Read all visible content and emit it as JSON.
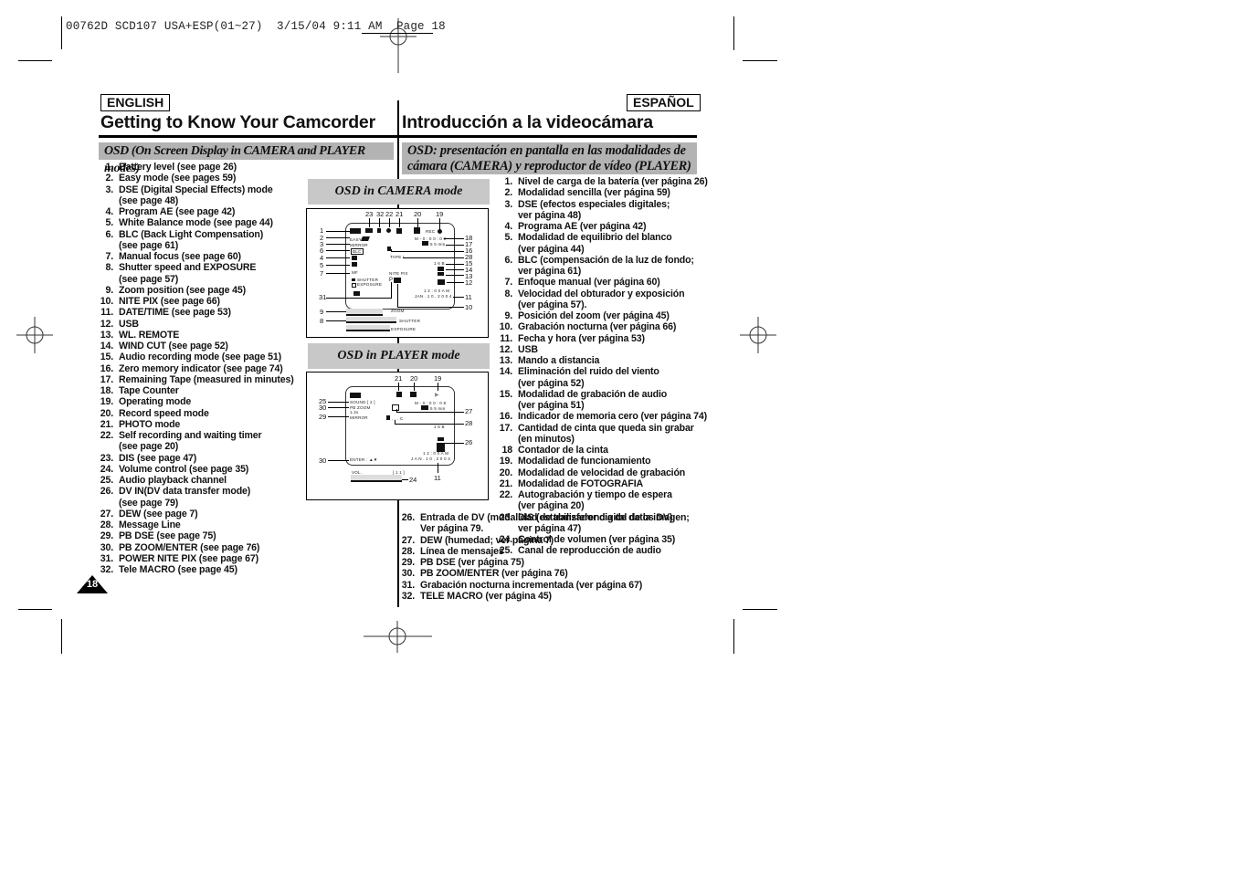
{
  "slug_line": "00762D SCD107 USA+ESP(01~27)  3/15/04 9:11 AM  Page 18",
  "english": {
    "lang_tag": "ENGLISH",
    "title": "Getting to Know Your Camcorder",
    "section_banner": "OSD (On Screen Display in CAMERA and PLAYER modes)",
    "items": [
      {
        "n": "1.",
        "t": "Battery level (see page 26)"
      },
      {
        "n": "2.",
        "t": "Easy mode (see pages 59)"
      },
      {
        "n": "3.",
        "t": "DSE (Digital Special Effects) mode"
      },
      {
        "n": "",
        "t": "(see page 48)"
      },
      {
        "n": "4.",
        "t": "Program AE (see page 42)"
      },
      {
        "n": "5.",
        "t": "White Balance mode (see page 44)"
      },
      {
        "n": "6.",
        "t": "BLC (Back Light Compensation)"
      },
      {
        "n": "",
        "t": "(see page 61)"
      },
      {
        "n": "7.",
        "t": "Manual focus (see page 60)"
      },
      {
        "n": "8.",
        "t": "Shutter speed and EXPOSURE"
      },
      {
        "n": "",
        "t": "(see page 57)"
      },
      {
        "n": "9.",
        "t": "Zoom position (see page 45)"
      },
      {
        "n": "10.",
        "t": "NITE PIX (see page 66)"
      },
      {
        "n": "11.",
        "t": "DATE/TIME (see page 53)"
      },
      {
        "n": "12.",
        "t": "USB"
      },
      {
        "n": "13.",
        "t": "WL. REMOTE"
      },
      {
        "n": "14.",
        "t": "WIND CUT (see page 52)"
      },
      {
        "n": "15.",
        "t": "Audio recording mode (see page 51)"
      },
      {
        "n": "16.",
        "t": "Zero memory indicator (see page 74)"
      },
      {
        "n": "17.",
        "t": "Remaining Tape (measured in minutes)"
      },
      {
        "n": "18.",
        "t": "Tape Counter"
      },
      {
        "n": "19.",
        "t": "Operating mode"
      },
      {
        "n": "20.",
        "t": "Record speed mode"
      },
      {
        "n": "21.",
        "t": "PHOTO mode"
      },
      {
        "n": "22.",
        "t": "Self recording and waiting timer"
      },
      {
        "n": "",
        "t": "(see page 20)"
      },
      {
        "n": "23.",
        "t": "DIS (see page 47)"
      },
      {
        "n": "24.",
        "t": "Volume control (see page 35)"
      },
      {
        "n": "25.",
        "t": "Audio playback channel"
      },
      {
        "n": "26.",
        "t": "DV IN(DV data transfer mode)"
      },
      {
        "n": "",
        "t": "(see page 79)"
      },
      {
        "n": "27.",
        "t": "DEW (see page 7)"
      },
      {
        "n": "28.",
        "t": "Message Line"
      },
      {
        "n": "29.",
        "t": "PB DSE (see page 75)"
      },
      {
        "n": "30.",
        "t": "PB ZOOM/ENTER (see page 76)"
      },
      {
        "n": "31.",
        "t": "POWER NITE PIX (see page 67)"
      },
      {
        "n": "32.",
        "t": "Tele MACRO (see page 45)"
      }
    ],
    "page_number": "18"
  },
  "spanish": {
    "lang_tag": "ESPAÑOL",
    "title": "Introducción a la videocámara",
    "section_banner_line1": "OSD: presentación en pantalla en las modalidades de",
    "section_banner_line2": "cámara (CAMERA) y reproductor de vídeo (PLAYER)",
    "items_a": [
      {
        "n": "1.",
        "t": "Nivel de carga de la batería (ver página 26)"
      },
      {
        "n": "2.",
        "t": "Modalidad sencilla (ver página 59)"
      },
      {
        "n": "3.",
        "t": "DSE (efectos especiales digitales;"
      },
      {
        "n": "",
        "t": "ver página 48)"
      },
      {
        "n": "4.",
        "t": "Programa AE (ver página 42)"
      },
      {
        "n": "5.",
        "t": "Modalidad de equilibrio del blanco"
      },
      {
        "n": "",
        "t": "(ver página 44)"
      },
      {
        "n": "6.",
        "t": "BLC (compensación de la luz de fondo;"
      },
      {
        "n": "",
        "t": "ver página 61)"
      },
      {
        "n": "7.",
        "t": "Enfoque manual (ver página 60)"
      },
      {
        "n": "8.",
        "t": "Velocidad del obturador y exposición"
      },
      {
        "n": "",
        "t": "(ver página 57)."
      },
      {
        "n": "9.",
        "t": "Posición del zoom (ver página 45)"
      },
      {
        "n": "10.",
        "t": "Grabación nocturna (ver página 66)"
      },
      {
        "n": "11.",
        "t": "Fecha y hora (ver página 53)"
      },
      {
        "n": "12.",
        "t": "USB"
      },
      {
        "n": "13.",
        "t": "Mando a distancia"
      },
      {
        "n": "14.",
        "t": "Eliminación del ruido del viento"
      },
      {
        "n": "",
        "t": "(ver página 52)"
      },
      {
        "n": "15.",
        "t": "Modalidad de grabación de audio"
      },
      {
        "n": "",
        "t": "(ver página 51)"
      },
      {
        "n": "16.",
        "t": "Indicador de memoria cero (ver página 74)"
      },
      {
        "n": "17.",
        "t": "Cantidad de cinta que queda sin grabar"
      },
      {
        "n": "",
        "t": "(en minutos)"
      },
      {
        "n": "18",
        "t": "Contador de la cinta"
      },
      {
        "n": "19.",
        "t": "Modalidad de funcionamiento"
      },
      {
        "n": "20.",
        "t": "Modalidad de velocidad de grabación"
      },
      {
        "n": "21.",
        "t": "Modalidad de FOTOGRAFIA"
      },
      {
        "n": "22.",
        "t": "Autograbación y tiempo de espera"
      },
      {
        "n": "",
        "t": "(ver página 20)"
      },
      {
        "n": "23.",
        "t": "DIS (estabilizador digital de la imagen;"
      },
      {
        "n": "",
        "t": "ver página 47)"
      },
      {
        "n": "24.",
        "t": "Control de volumen (ver página 35)"
      },
      {
        "n": "25.",
        "t": "Canal de reproducción de audio"
      }
    ],
    "items_b": [
      {
        "n": "26.",
        "t": "Entrada de DV (modalidad de transferencia de datos DV)"
      },
      {
        "n": "",
        "t": "Ver página 79."
      },
      {
        "n": "27.",
        "t": "DEW (humedad; ver página 7)"
      },
      {
        "n": "28.",
        "t": "Línea de mensajes"
      },
      {
        "n": "29.",
        "t": "PB DSE (ver página 75)"
      },
      {
        "n": "30.",
        "t": "PB ZOOM/ENTER (ver página 76)"
      },
      {
        "n": "31.",
        "t": "Grabación nocturna incrementada (ver página 67)"
      },
      {
        "n": "32.",
        "t": "TELE MACRO (ver página 45)"
      }
    ]
  },
  "osd_camera": {
    "label": "OSD in CAMERA mode",
    "top_callouts": [
      "23",
      "32",
      "22",
      "21",
      "20",
      "19"
    ],
    "left_callouts": [
      "1",
      "2",
      "3",
      "6",
      "4",
      "5",
      "7",
      "31",
      "9",
      "8"
    ],
    "right_callouts": [
      "18",
      "17",
      "16",
      "28",
      "15",
      "14",
      "13",
      "12",
      "11",
      "10"
    ],
    "screen_text": {
      "rec": "REC",
      "counter": "M - 0 : 0 0 : 0 0",
      "remaining": "5 5 min",
      "easy": "EASY",
      "mirror": "MIRROR",
      "blc": "BLC",
      "tape": "TAPE !",
      "audio": "1 6 B",
      "mf": "MF",
      "nite_pix": "NITE PIX",
      "nite_p": "P",
      "shutter": "SHUTTER",
      "exposure": "EXPOSURE",
      "time": "1 2 : 0 0 A M",
      "date": "JAN . 1 0 , 2 0 0 4",
      "zoom": "ZOOM",
      "shutter_bar": "SHUTTER",
      "exposure_bar": "EXPOSURE"
    }
  },
  "osd_player": {
    "label": "OSD in PLAYER mode",
    "top_callouts": [
      "21",
      "20",
      "19"
    ],
    "left_callouts": [
      "25",
      "30",
      "29",
      "30"
    ],
    "right_callouts": [
      "27",
      "28",
      "26"
    ],
    "bottom_callouts": [
      "24",
      "11"
    ],
    "screen_text": {
      "sound": "SOUND [ 2 ]",
      "pb_zoom": "PB ZOOM",
      "pb_zoom_val": "1.2x",
      "mirror": "MIRROR",
      "counter": "M - 0 : 0 0 : 0 8",
      "remaining": "5 5 min",
      "message": ". . . C",
      "audio": "1 6 B",
      "enter": "ENTER : ▲▼",
      "time": "1 2 : 0 0 A M",
      "date": "J A N . 1 0 , 2 0 0 4",
      "vol": "VOL.",
      "vol_val": "[ 1 1 ]"
    }
  }
}
